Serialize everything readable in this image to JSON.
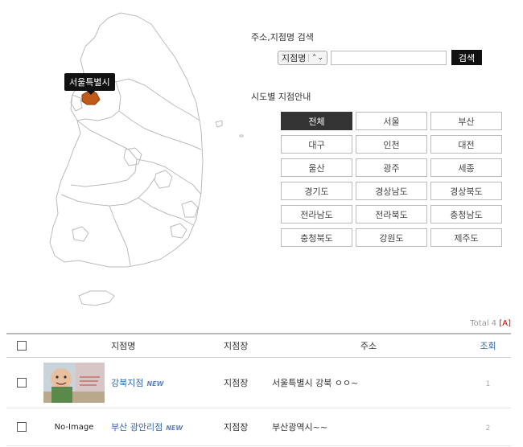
{
  "map": {
    "tooltip": "서울특별시",
    "region_fill": "#c05a1a"
  },
  "search": {
    "title": "주소,지점명 검색",
    "select_value": "지점명",
    "input_value": "",
    "button": "검색"
  },
  "regions": {
    "title": "시도별 지점안내",
    "items": [
      "전체",
      "서울",
      "부산",
      "대구",
      "인천",
      "대전",
      "울산",
      "광주",
      "세종",
      "경기도",
      "경상남도",
      "경상북도",
      "전라남도",
      "전라북도",
      "충청남도",
      "충청북도",
      "강원도",
      "제주도"
    ],
    "active_index": 0
  },
  "list": {
    "total_label": "Total 4",
    "admin_label": "[A]",
    "columns": {
      "name": "지점명",
      "manager": "지점장",
      "address": "주소",
      "views": "조회"
    },
    "rows": [
      {
        "thumb": "image",
        "name": "강북지점",
        "badge": "NEW",
        "manager": "지점장",
        "address": "서울특별시 강북 ㅇㅇ~",
        "views": "1"
      },
      {
        "thumb": "No-Image",
        "name": "부산 광안리점",
        "badge": "NEW",
        "manager": "지점장",
        "address": "부산광역시~~",
        "views": "2"
      }
    ]
  }
}
